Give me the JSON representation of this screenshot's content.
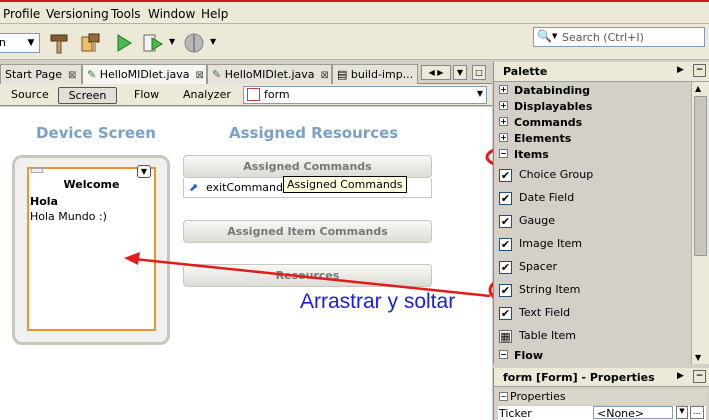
{
  "menubar": {
    "items": [
      "Profile",
      "Versioning",
      "Tools",
      "Window",
      "Help"
    ]
  },
  "toolbar": {
    "combo_value": "n"
  },
  "search": {
    "placeholder": "Search (Ctrl+I)"
  },
  "editor": {
    "tabs": [
      "Start Page",
      "HelloMIDlet.java",
      "HelloMIDlet.java",
      "build-imp..."
    ],
    "views": [
      "Source",
      "Screen",
      "Flow",
      "Analyzer"
    ],
    "active_view": "Screen",
    "form_selector": "form"
  },
  "canvas": {
    "device_title": "Device Screen",
    "resources_title": "Assigned Resources",
    "screen_header": "Welcome",
    "screen_line1": "Hola",
    "screen_line2": "Hola Mundo :)",
    "panel_commands": "Assigned Commands",
    "exit_command": "exitCommand",
    "tooltip": "Assigned Commands",
    "panel_item_commands": "Assigned Item Commands",
    "panel_resources": "Resources",
    "annotation": "Arrastrar y soltar"
  },
  "palette": {
    "title": "Palette",
    "categories": [
      "Databinding",
      "Displayables",
      "Commands",
      "Elements",
      "Items"
    ],
    "items": [
      "Choice Group",
      "Date Field",
      "Gauge",
      "Image Item",
      "Spacer",
      "String Item",
      "Text Field",
      "Table Item"
    ],
    "flow": "Flow"
  },
  "properties": {
    "title": "form [Form] - Properties",
    "section": "Properties",
    "row_label": "Ticker",
    "row_value": "<None>"
  },
  "colors": {
    "annotation_red": "#e21b1b",
    "annotation_blue": "#1d1de0",
    "device_orange": "#f0922d"
  }
}
